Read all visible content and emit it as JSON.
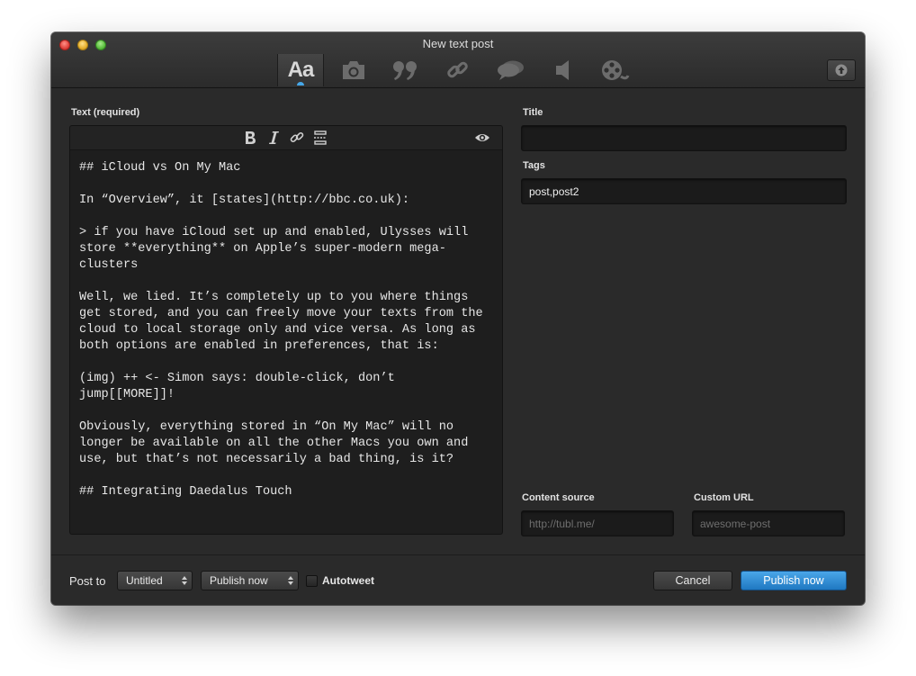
{
  "window": {
    "title": "New text post"
  },
  "post_types": [
    {
      "name": "text",
      "label": "Aa",
      "icon": "text-icon",
      "active": true
    },
    {
      "name": "photo",
      "icon": "camera-icon",
      "active": false
    },
    {
      "name": "quote",
      "icon": "quote-icon",
      "active": false
    },
    {
      "name": "link",
      "icon": "link-icon",
      "active": false
    },
    {
      "name": "chat",
      "icon": "chat-bubble-icon",
      "active": false
    },
    {
      "name": "audio",
      "icon": "speaker-icon",
      "active": false
    },
    {
      "name": "video",
      "icon": "film-reel-icon",
      "active": false
    }
  ],
  "upload_icon": "upload-icon",
  "text_field": {
    "label": "Text (required)",
    "toolbar": [
      "bold-icon",
      "italic-icon",
      "link-icon",
      "more-break-icon",
      "preview-eye-icon"
    ],
    "content": "## iCloud vs On My Mac\n\nIn “Overview”, it [states](http://bbc.co.uk):\n\n> if you have iCloud set up and enabled, Ulysses will store **everything** on Apple’s super-modern mega-clusters\n\nWell, we lied. It’s completely up to you where things get stored, and you can freely move your texts from the cloud to local storage only and vice versa. As long as both options are enabled in preferences, that is:\n\n(img) ++ <- Simon says: double-click, don’t jump[[MORE]]!\n\nObviously, everything stored in “On My Mac” will no longer be available on all the other Macs you own and use, but that’s not necessarily a bad thing, is it?\n\n## Integrating Daedalus Touch"
  },
  "title_field": {
    "label": "Title",
    "value": ""
  },
  "tags_field": {
    "label": "Tags",
    "value": "post,post2"
  },
  "content_source": {
    "label": "Content source",
    "placeholder": "http://tubl.me/"
  },
  "custom_url": {
    "label": "Custom URL",
    "placeholder": "awesome-post"
  },
  "footer": {
    "post_to_label": "Post to",
    "blog_select": "Untitled",
    "schedule_select": "Publish now",
    "autotweet_label": "Autotweet",
    "autotweet_checked": false,
    "cancel_label": "Cancel",
    "publish_label": "Publish now"
  },
  "colors": {
    "accent": "#2a86d2",
    "background": "#2a2a2a"
  }
}
